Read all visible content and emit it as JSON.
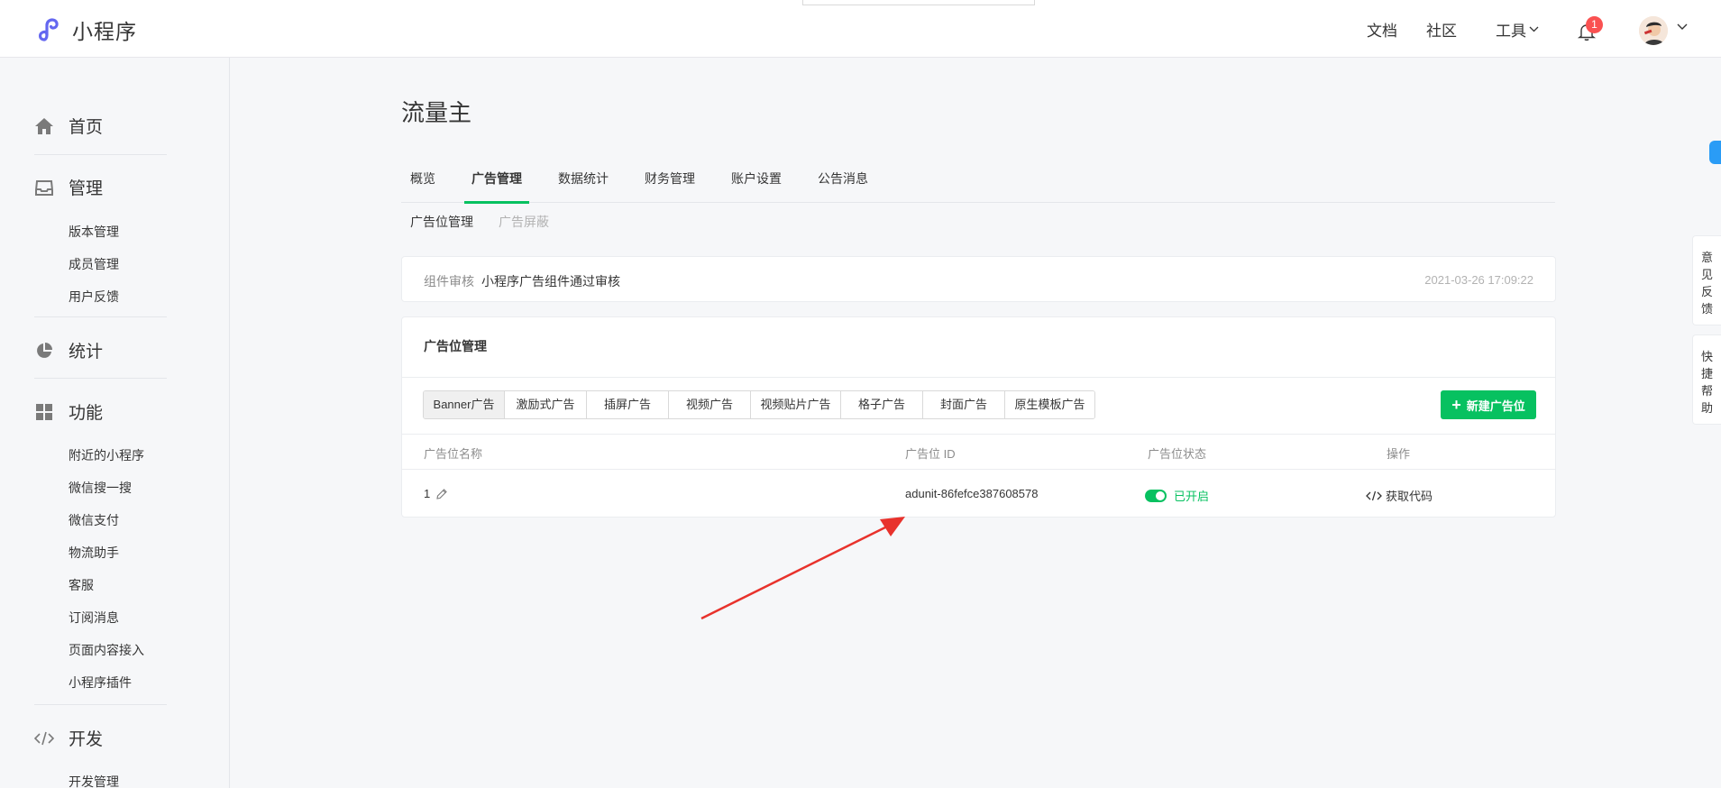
{
  "header": {
    "app_name": "小程序",
    "nav": {
      "docs": "文档",
      "community": "社区",
      "tools": "工具"
    },
    "notification_count": "1"
  },
  "sidebar": {
    "sections": [
      {
        "label": "首页",
        "icon": "home-icon",
        "items": []
      },
      {
        "label": "管理",
        "icon": "inbox-icon",
        "items": [
          "版本管理",
          "成员管理",
          "用户反馈"
        ]
      },
      {
        "label": "统计",
        "icon": "pie-chart-icon",
        "items": []
      },
      {
        "label": "功能",
        "icon": "grid-icon",
        "items": [
          "附近的小程序",
          "微信搜一搜",
          "微信支付",
          "物流助手",
          "客服",
          "订阅消息",
          "页面内容接入",
          "小程序插件"
        ]
      },
      {
        "label": "开发",
        "icon": "code-icon",
        "items": [
          "开发管理"
        ]
      }
    ]
  },
  "main": {
    "title": "流量主",
    "tabs": [
      "概览",
      "广告管理",
      "数据统计",
      "财务管理",
      "账户设置",
      "公告消息"
    ],
    "active_tab": "广告管理",
    "subtabs": [
      "广告位管理",
      "广告屏蔽"
    ],
    "review": {
      "label": "组件审核",
      "value": "小程序广告组件通过审核",
      "time": "2021-03-26 17:09:22"
    },
    "ad_slots": {
      "title": "广告位管理",
      "types": [
        "Banner广告",
        "激励式广告",
        "插屏广告",
        "视频广告",
        "视频贴片广告",
        "格子广告",
        "封面广告",
        "原生模板广告"
      ],
      "active_type": "Banner广告",
      "new_button": "新建广告位",
      "columns": {
        "name": "广告位名称",
        "id": "广告位 ID",
        "status": "广告位状态",
        "action": "操作"
      },
      "rows": [
        {
          "name": "1",
          "id": "adunit-86fefce387608578",
          "status": "已开启",
          "action": "获取代码"
        }
      ]
    }
  },
  "float": {
    "feedback": [
      "意",
      "见",
      "反",
      "馈"
    ],
    "help": [
      "快",
      "捷",
      "帮",
      "助"
    ]
  },
  "colors": {
    "accent": "#07c160",
    "badge": "#fa5151",
    "arrow": "#e8322c",
    "float_blue": "#2a9cf6"
  }
}
